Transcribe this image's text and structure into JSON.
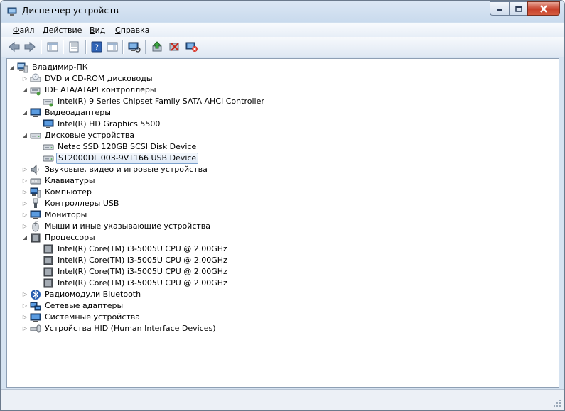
{
  "window": {
    "title": "Диспетчер устройств"
  },
  "menu": [
    {
      "label": "Файл",
      "key": "Ф",
      "rest": "айл"
    },
    {
      "label": "Действие",
      "key": "Д",
      "rest": "ействие"
    },
    {
      "label": "Вид",
      "key": "В",
      "rest": "ид"
    },
    {
      "label": "Справка",
      "key": "С",
      "rest": "правка"
    }
  ],
  "toolbar": {
    "buttons": [
      "back",
      "forward",
      "show-hide-console-tree",
      "properties",
      "help",
      "action-pane",
      "scan-hardware",
      "update-driver",
      "disable-device",
      "uninstall-device"
    ]
  },
  "tree": {
    "root": "Владимир-ПК",
    "nodes": [
      {
        "label": "DVD и CD-ROM дисководы",
        "icon": "dvd-drive-icon",
        "expanded": false,
        "children": []
      },
      {
        "label": "IDE ATA/ATAPI контроллеры",
        "icon": "ide-controller-icon",
        "expanded": true,
        "children": [
          {
            "label": "Intel(R) 9 Series Chipset Family SATA AHCI Controller",
            "icon": "ide-controller-icon"
          }
        ]
      },
      {
        "label": "Видеоадаптеры",
        "icon": "display-adapter-icon",
        "expanded": true,
        "children": [
          {
            "label": "Intel(R) HD Graphics 5500",
            "icon": "display-adapter-icon"
          }
        ]
      },
      {
        "label": "Дисковые устройства",
        "icon": "disk-drive-icon",
        "expanded": true,
        "children": [
          {
            "label": "Netac SSD 120GB SCSI Disk Device",
            "icon": "disk-drive-icon"
          },
          {
            "label": "ST2000DL 003-9VT166 USB Device",
            "icon": "disk-drive-icon",
            "selected": true
          }
        ]
      },
      {
        "label": "Звуковые, видео и игровые устройства",
        "icon": "speaker-icon",
        "expanded": false,
        "children": []
      },
      {
        "label": "Клавиатуры",
        "icon": "keyboard-icon",
        "expanded": false,
        "children": []
      },
      {
        "label": "Компьютер",
        "icon": "computer-icon",
        "expanded": false,
        "children": []
      },
      {
        "label": "Контроллеры USB",
        "icon": "usb-icon",
        "expanded": false,
        "children": []
      },
      {
        "label": "Мониторы",
        "icon": "monitor-icon",
        "expanded": false,
        "children": []
      },
      {
        "label": "Мыши и иные указывающие устройства",
        "icon": "mouse-icon",
        "expanded": false,
        "children": []
      },
      {
        "label": "Процессоры",
        "icon": "processor-icon",
        "expanded": true,
        "children": [
          {
            "label": "Intel(R) Core(TM) i3-5005U CPU @ 2.00GHz",
            "icon": "processor-icon"
          },
          {
            "label": "Intel(R) Core(TM) i3-5005U CPU @ 2.00GHz",
            "icon": "processor-icon"
          },
          {
            "label": "Intel(R) Core(TM) i3-5005U CPU @ 2.00GHz",
            "icon": "processor-icon"
          },
          {
            "label": "Intel(R) Core(TM) i3-5005U CPU @ 2.00GHz",
            "icon": "processor-icon"
          }
        ]
      },
      {
        "label": "Радиомодули Bluetooth",
        "icon": "bluetooth-icon",
        "expanded": false,
        "children": []
      },
      {
        "label": "Сетевые адаптеры",
        "icon": "network-adapter-icon",
        "expanded": false,
        "children": []
      },
      {
        "label": "Системные устройства",
        "icon": "system-devices-icon",
        "expanded": false,
        "children": []
      },
      {
        "label": "Устройства HID (Human Interface Devices)",
        "icon": "hid-icon",
        "expanded": false,
        "children": []
      }
    ]
  },
  "colors": {
    "selection_border": "#7da2ce",
    "chrome": "#dbe7f4"
  }
}
